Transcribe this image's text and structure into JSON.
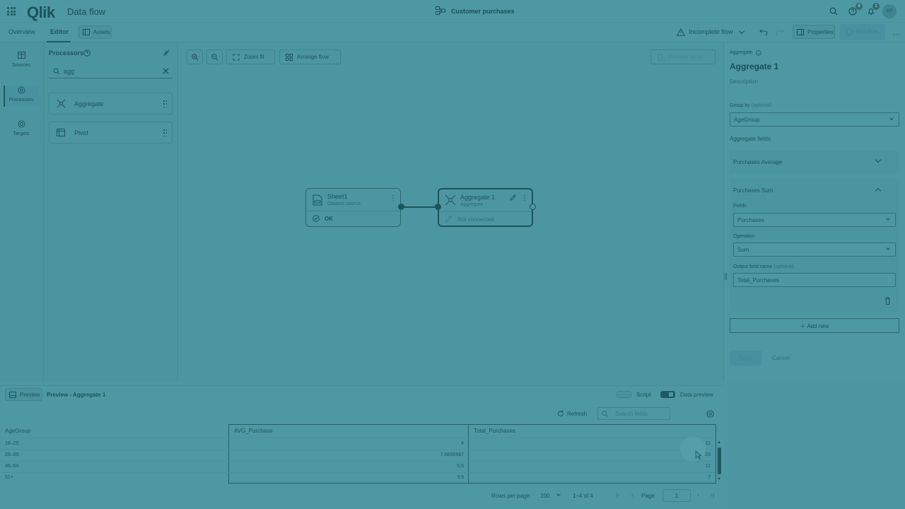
{
  "header": {
    "logo": "Qlik",
    "app_name": "Data flow",
    "flow_name": "Customer purchases",
    "help_badge": "8",
    "notif_badge": "1",
    "avatar": "GP"
  },
  "tabs": {
    "overview": "Overview",
    "editor": "Editor",
    "assets": "Assets"
  },
  "toolbar": {
    "status": "Incomplete flow",
    "properties": "Properties",
    "run_flow": "Run flow"
  },
  "leftnav": {
    "sources": "Sources",
    "processors": "Processors",
    "targets": "Targets"
  },
  "processors_panel": {
    "title": "Processors",
    "search_value": "agg",
    "items": [
      "Aggregate",
      "Pivot"
    ]
  },
  "canvas": {
    "zoom_fit": "Zoom fit",
    "arrange_flow": "Arrange flow",
    "preview_script": "Preview script",
    "nodes": [
      {
        "title": "Sheet1",
        "subtitle": "Dataset source",
        "status": "OK"
      },
      {
        "title": "Aggregate 1",
        "subtitle": "Aggregate",
        "status": "Not connected"
      }
    ]
  },
  "properties": {
    "type_label": "Aggregate",
    "name": "Aggregate 1",
    "description": "Description",
    "group_by_label": "Group by",
    "optional": "(optional)",
    "group_by_value": "AgeGroup",
    "aggregate_fields": "Aggregate fields",
    "agg1_name": "Purchases Average",
    "agg2_name": "Purchases Sum",
    "fields_label": "Fields",
    "fields_value": "Purchases",
    "operation_label": "Operation",
    "operation_value": "Sum",
    "output_label": "Output field name",
    "output_value": "Total_Purchases",
    "add_new": "Add new",
    "apply": "Apply",
    "cancel": "Cancel"
  },
  "preview": {
    "button": "Preview",
    "title": "Preview - Aggregate 1",
    "script": "Script",
    "data_preview": "Data preview",
    "refresh": "Refresh",
    "search_placeholder": "Search fields",
    "columns": [
      "AgeGroup",
      "AVG_Purchase",
      "Total_Purchases"
    ],
    "rows": [
      [
        "18–25",
        "4",
        "12"
      ],
      [
        "26–35",
        "7.6666667",
        "23"
      ],
      [
        "36–50",
        "5.5",
        "11"
      ],
      [
        "51+",
        "3.5",
        "7"
      ]
    ],
    "rows_per_page_label": "Rows per page:",
    "rows_per_page": "100",
    "range": "1–4 of 4",
    "page_label": "Page",
    "page": "1"
  }
}
